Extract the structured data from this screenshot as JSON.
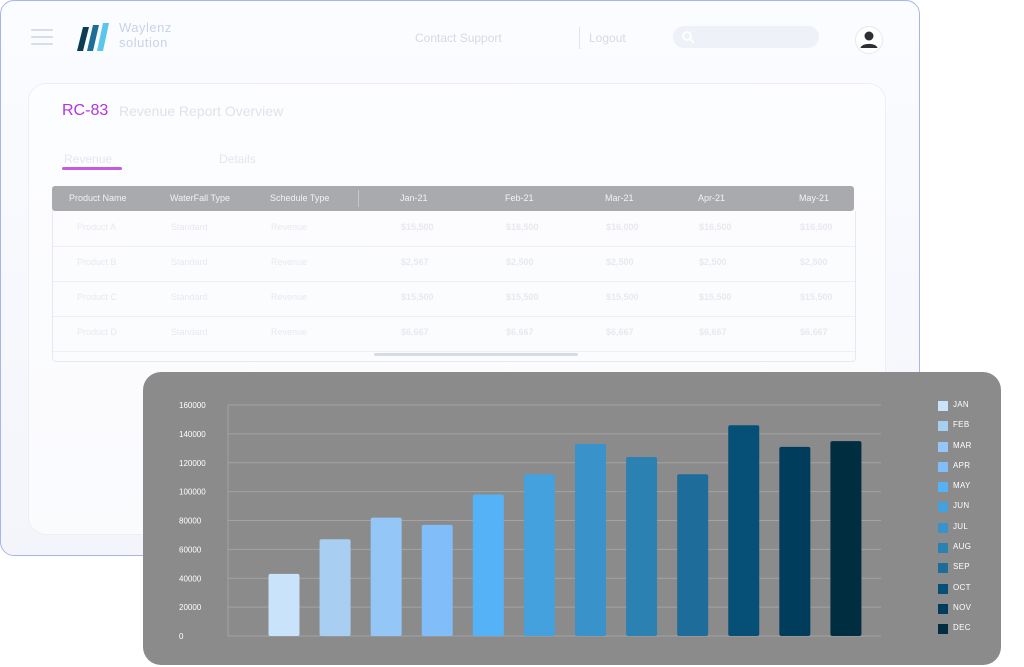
{
  "header": {
    "brand_line1": "Waylenz",
    "brand_line2": "solution",
    "link_1": "Contact Support",
    "link_2": "Logout",
    "search_placeholder": ""
  },
  "card": {
    "title": "RC-83",
    "subtitle": "Revenue Report Overview",
    "tabs": [
      "Revenue",
      "Details"
    ]
  },
  "table": {
    "headers": [
      "Product Name",
      "WaterFall Type",
      "Schedule Type",
      "Jan-21",
      "Feb-21",
      "Mar-21",
      "Apr-21",
      "May-21"
    ],
    "rows": [
      [
        "Product A",
        "Standard",
        "Revenue",
        "$15,500",
        "$16,500",
        "$16,000",
        "$16,500",
        "$16,500"
      ],
      [
        "Product B",
        "Standard",
        "Revenue",
        "$2,567",
        "$2,500",
        "$2,500",
        "$2,500",
        "$2,500"
      ],
      [
        "Product C",
        "Standard",
        "Revenue",
        "$15,500",
        "$15,500",
        "$15,500",
        "$15,500",
        "$15,500"
      ],
      [
        "Product D",
        "Standard",
        "Revenue",
        "$6,667",
        "$6,667",
        "$6,667",
        "$6,667",
        "$6,667"
      ]
    ]
  },
  "chart_data": {
    "type": "bar",
    "categories": [
      "JAN",
      "FEB",
      "MAR",
      "APR",
      "MAY",
      "JUN",
      "JUL",
      "AUG",
      "SEP",
      "OCT",
      "NOV",
      "DEC"
    ],
    "values": [
      43000,
      67000,
      82000,
      77000,
      98000,
      112000,
      133000,
      124000,
      112000,
      146000,
      131000,
      135000
    ],
    "colors": [
      "#c9e3fa",
      "#a8cff1",
      "#94c6f7",
      "#80bdf9",
      "#55b2f6",
      "#45a0de",
      "#3a92cb",
      "#2b82b2",
      "#1e6c99",
      "#064f76",
      "#003c5c",
      "#002d40"
    ],
    "yticks": [
      0,
      20000,
      40000,
      60000,
      80000,
      100000,
      120000,
      140000,
      160000
    ],
    "ylim": [
      0,
      160000
    ],
    "title": "",
    "xlabel": "",
    "ylabel": "",
    "grid": true,
    "legend": "right"
  },
  "colors": {
    "accent": "#b533e0",
    "window_border": "#aab4ec",
    "chart_bg": "#8b8b8b"
  }
}
